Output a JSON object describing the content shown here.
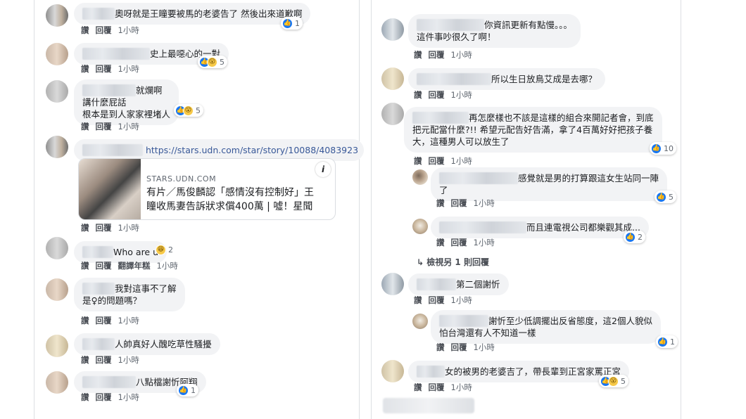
{
  "common": {
    "like_label": "讚",
    "reply_label": "回覆",
    "time_label": "1小時"
  },
  "left_comments": [
    {
      "text": "奧呀就是王瞳要被馬的老婆告了 然後出來道歉啊",
      "reactions": "1",
      "icons": [
        "like-icon"
      ]
    },
    {
      "text": "史上最噁心的一對",
      "reactions": "5",
      "icons": [
        "like-icon",
        "wow-icon"
      ]
    },
    {
      "text": "就爛啊\n講什麼屁話\n根本是到人家家裡堵人",
      "reactions": "5",
      "icons": [
        "like-icon",
        "wow-icon"
      ]
    },
    {
      "link_url": "https://stars.udn.com/star/story/10088/4083923",
      "card": {
        "domain": "STARS.UDN.COM",
        "title": "有片／馬俊麟認「感情沒有控制好」王\n瞳收馬妻告訴狀求償400萬 | 噓！星聞",
        "info_icon": "info-icon"
      }
    },
    {
      "text": "Who are u",
      "reactions": "2",
      "icons": [
        "haha-icon"
      ],
      "translate_label": "翻譯年糕"
    },
    {
      "text": "我對這事不了解\n是♀的問題嗎？"
    },
    {
      "text": "人帥真好人醜吃草性騷擾"
    },
    {
      "text": "八點檔謝忻阿翔",
      "reactions": "1",
      "icons": [
        "like-icon"
      ]
    }
  ],
  "right_comments": [
    {
      "text": "你資訊更新有點慢。。。\n這件事吵很久了啊！"
    },
    {
      "text": "所以生日放鳥艾成是去哪？"
    },
    {
      "text": "再怎麼樣也不該是這樣的組合來開記者會，到底\n把元配當什麼?!! 希望元配告好告滿，拿了4百萬好好把孩子養\n大，這種男人可以放生了",
      "reactions": "10",
      "icons": [
        "like-icon"
      ]
    },
    {
      "text": "感覺就是男的打算跟這女生站同一陣\n了",
      "reactions": "5",
      "icons": [
        "like-icon"
      ]
    },
    {
      "text": "而且連電視公司都樂觀其成...",
      "reactions": "2",
      "icons": [
        "like-icon"
      ]
    },
    {
      "view_more": "檢視另 1 則回覆",
      "arrow_icon": "reply-arrow-icon"
    },
    {
      "text": "第二個謝忻"
    },
    {
      "text": "謝忻至少低調擺出反省態度，這2個人貌似\n怕台灣還有人不知道一樣",
      "reactions": "1",
      "icons": [
        "like-icon"
      ]
    },
    {
      "text": "女的被男的老婆吉了，帶長輩到正宮家罵正宮",
      "reactions": "5",
      "icons": [
        "like-icon",
        "wow-icon"
      ]
    }
  ],
  "colors": {
    "link": "#385898",
    "like": "#1877f2",
    "bubble": "#f2f3f5",
    "meta": "#606770"
  }
}
